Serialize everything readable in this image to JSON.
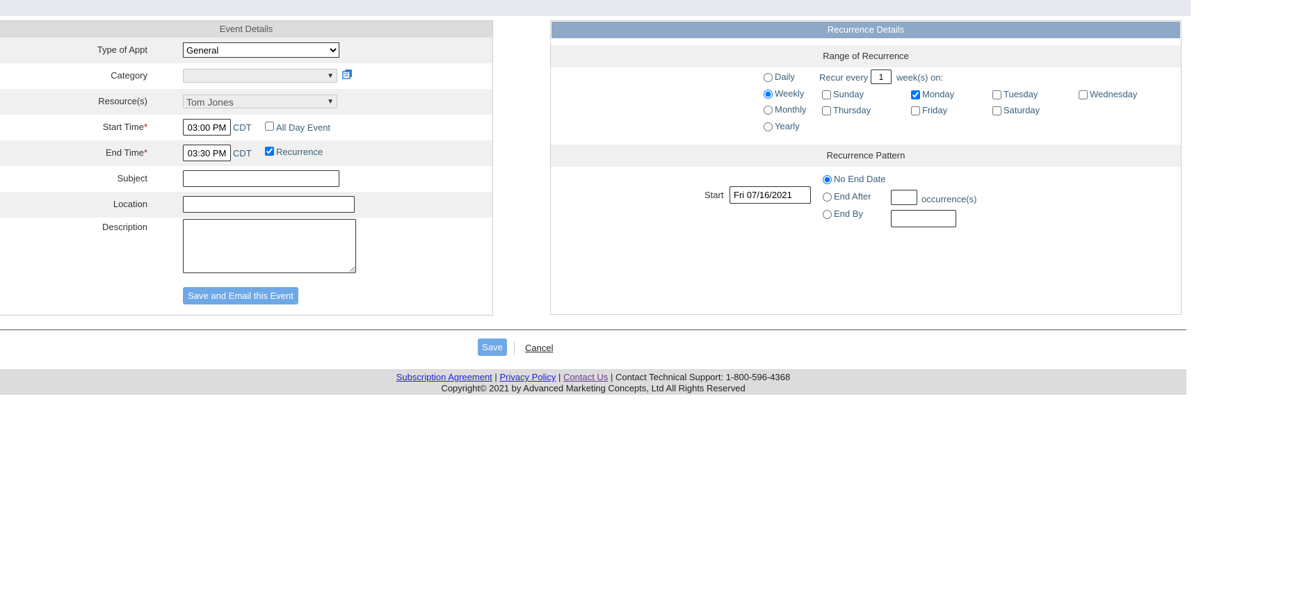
{
  "event": {
    "header": "Event Details",
    "type_label": "Type of Appt",
    "type_value": "General",
    "category_label": "Category",
    "category_value": "",
    "resources_label": "Resource(s)",
    "resources_value": "Tom Jones",
    "start_label": "Start Time",
    "start_value": "03:00 PM",
    "end_label": "End Time",
    "end_value": "03:30 PM",
    "required_mark": "*",
    "timezone": "CDT",
    "all_day_label": "All Day Event",
    "recurrence_label": "Recurrence",
    "subject_label": "Subject",
    "location_label": "Location",
    "description_label": "Description",
    "save_email_label": "Save and Email this Event"
  },
  "recurrence": {
    "header": "Recurrence Details",
    "range_header": "Range of Recurrence",
    "frequencies": [
      "Daily",
      "Weekly",
      "Monthly",
      "Yearly"
    ],
    "selected_frequency": "Weekly",
    "recur_every_label": "Recur every",
    "recur_every_value": "1",
    "weeks_on_label": "week(s) on:",
    "days": [
      "Sunday",
      "Monday",
      "Tuesday",
      "Wednesday",
      "Thursday",
      "Friday",
      "Saturday"
    ],
    "checked_days": [
      "Monday"
    ],
    "pattern_header": "Recurrence Pattern",
    "start_label": "Start",
    "start_value": "Fri 07/16/2021",
    "no_end_label": "No End Date",
    "end_after_label": "End After",
    "occurrences_label": "occurrence(s)",
    "end_by_label": "End By"
  },
  "actions": {
    "save_label": "Save",
    "cancel_label": "Cancel"
  },
  "footer": {
    "subscription": "Subscription Agreement",
    "privacy": "Privacy Policy",
    "contact": "Contact Us",
    "sep": "|",
    "support": "Contact Technical Support: 1-800-596-4368",
    "copyright": "Copyright© 2021 by Advanced Marketing Concepts, Ltd All Rights Reserved"
  },
  "colors": {
    "accent_button": "#6fa8e6",
    "recurrence_header": "#8ea8c8",
    "required": "#cc0000"
  }
}
